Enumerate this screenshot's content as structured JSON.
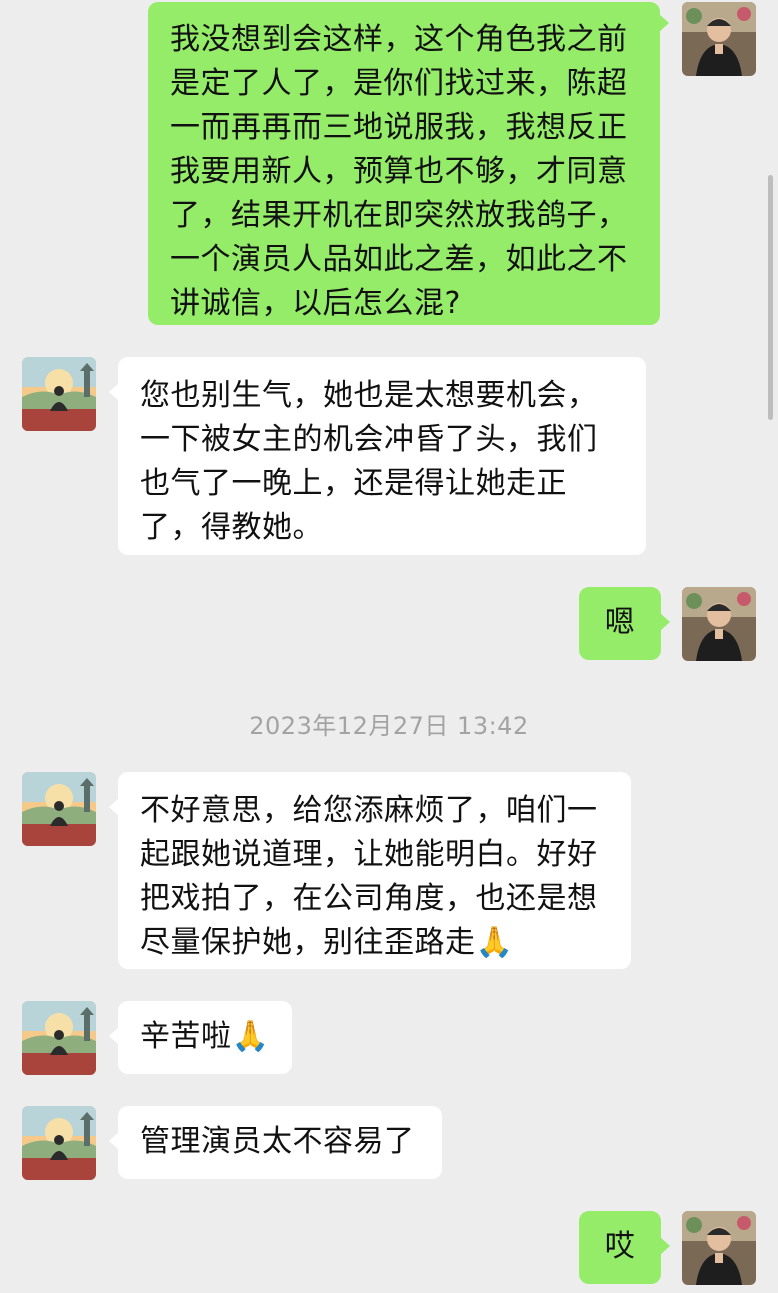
{
  "conversation": {
    "messages": [
      {
        "sender": "me",
        "text": "我没想到会这样，这个角色我之前是定了人了，是你们找过来，陈超一而再再而三地说服我，我想反正我要用新人，预算也不够，才同意了，结果开机在即突然放我鸽子，一个演员人品如此之差，如此之不讲诚信，以后怎么混?"
      },
      {
        "sender": "other",
        "text": "您也别生气，她也是太想要机会，一下被女主的机会冲昏了头，我们也气了一晚上，还是得让她走正了，得教她。"
      },
      {
        "sender": "me",
        "text": "嗯"
      },
      {
        "sender": "other",
        "text": "不好意思，给您添麻烦了，咱们一起跟她说道理，让她能明白。好好把戏拍了，在公司角度，也还是想尽量保护她，别往歪路走🙏"
      },
      {
        "sender": "other",
        "text": "辛苦啦🙏"
      },
      {
        "sender": "other",
        "text": "管理演员太不容易了"
      },
      {
        "sender": "me",
        "text": "哎"
      }
    ],
    "timestamp": "2023年12月27日 13:42"
  },
  "colors": {
    "background": "#ededed",
    "my_bubble": "#95ec69",
    "other_bubble": "#ffffff",
    "timestamp_text": "#a3a3a3"
  },
  "icons": {
    "my_avatar": "man-in-black-shirt-avatar",
    "other_avatar": "meditation-sunset-avatar"
  }
}
